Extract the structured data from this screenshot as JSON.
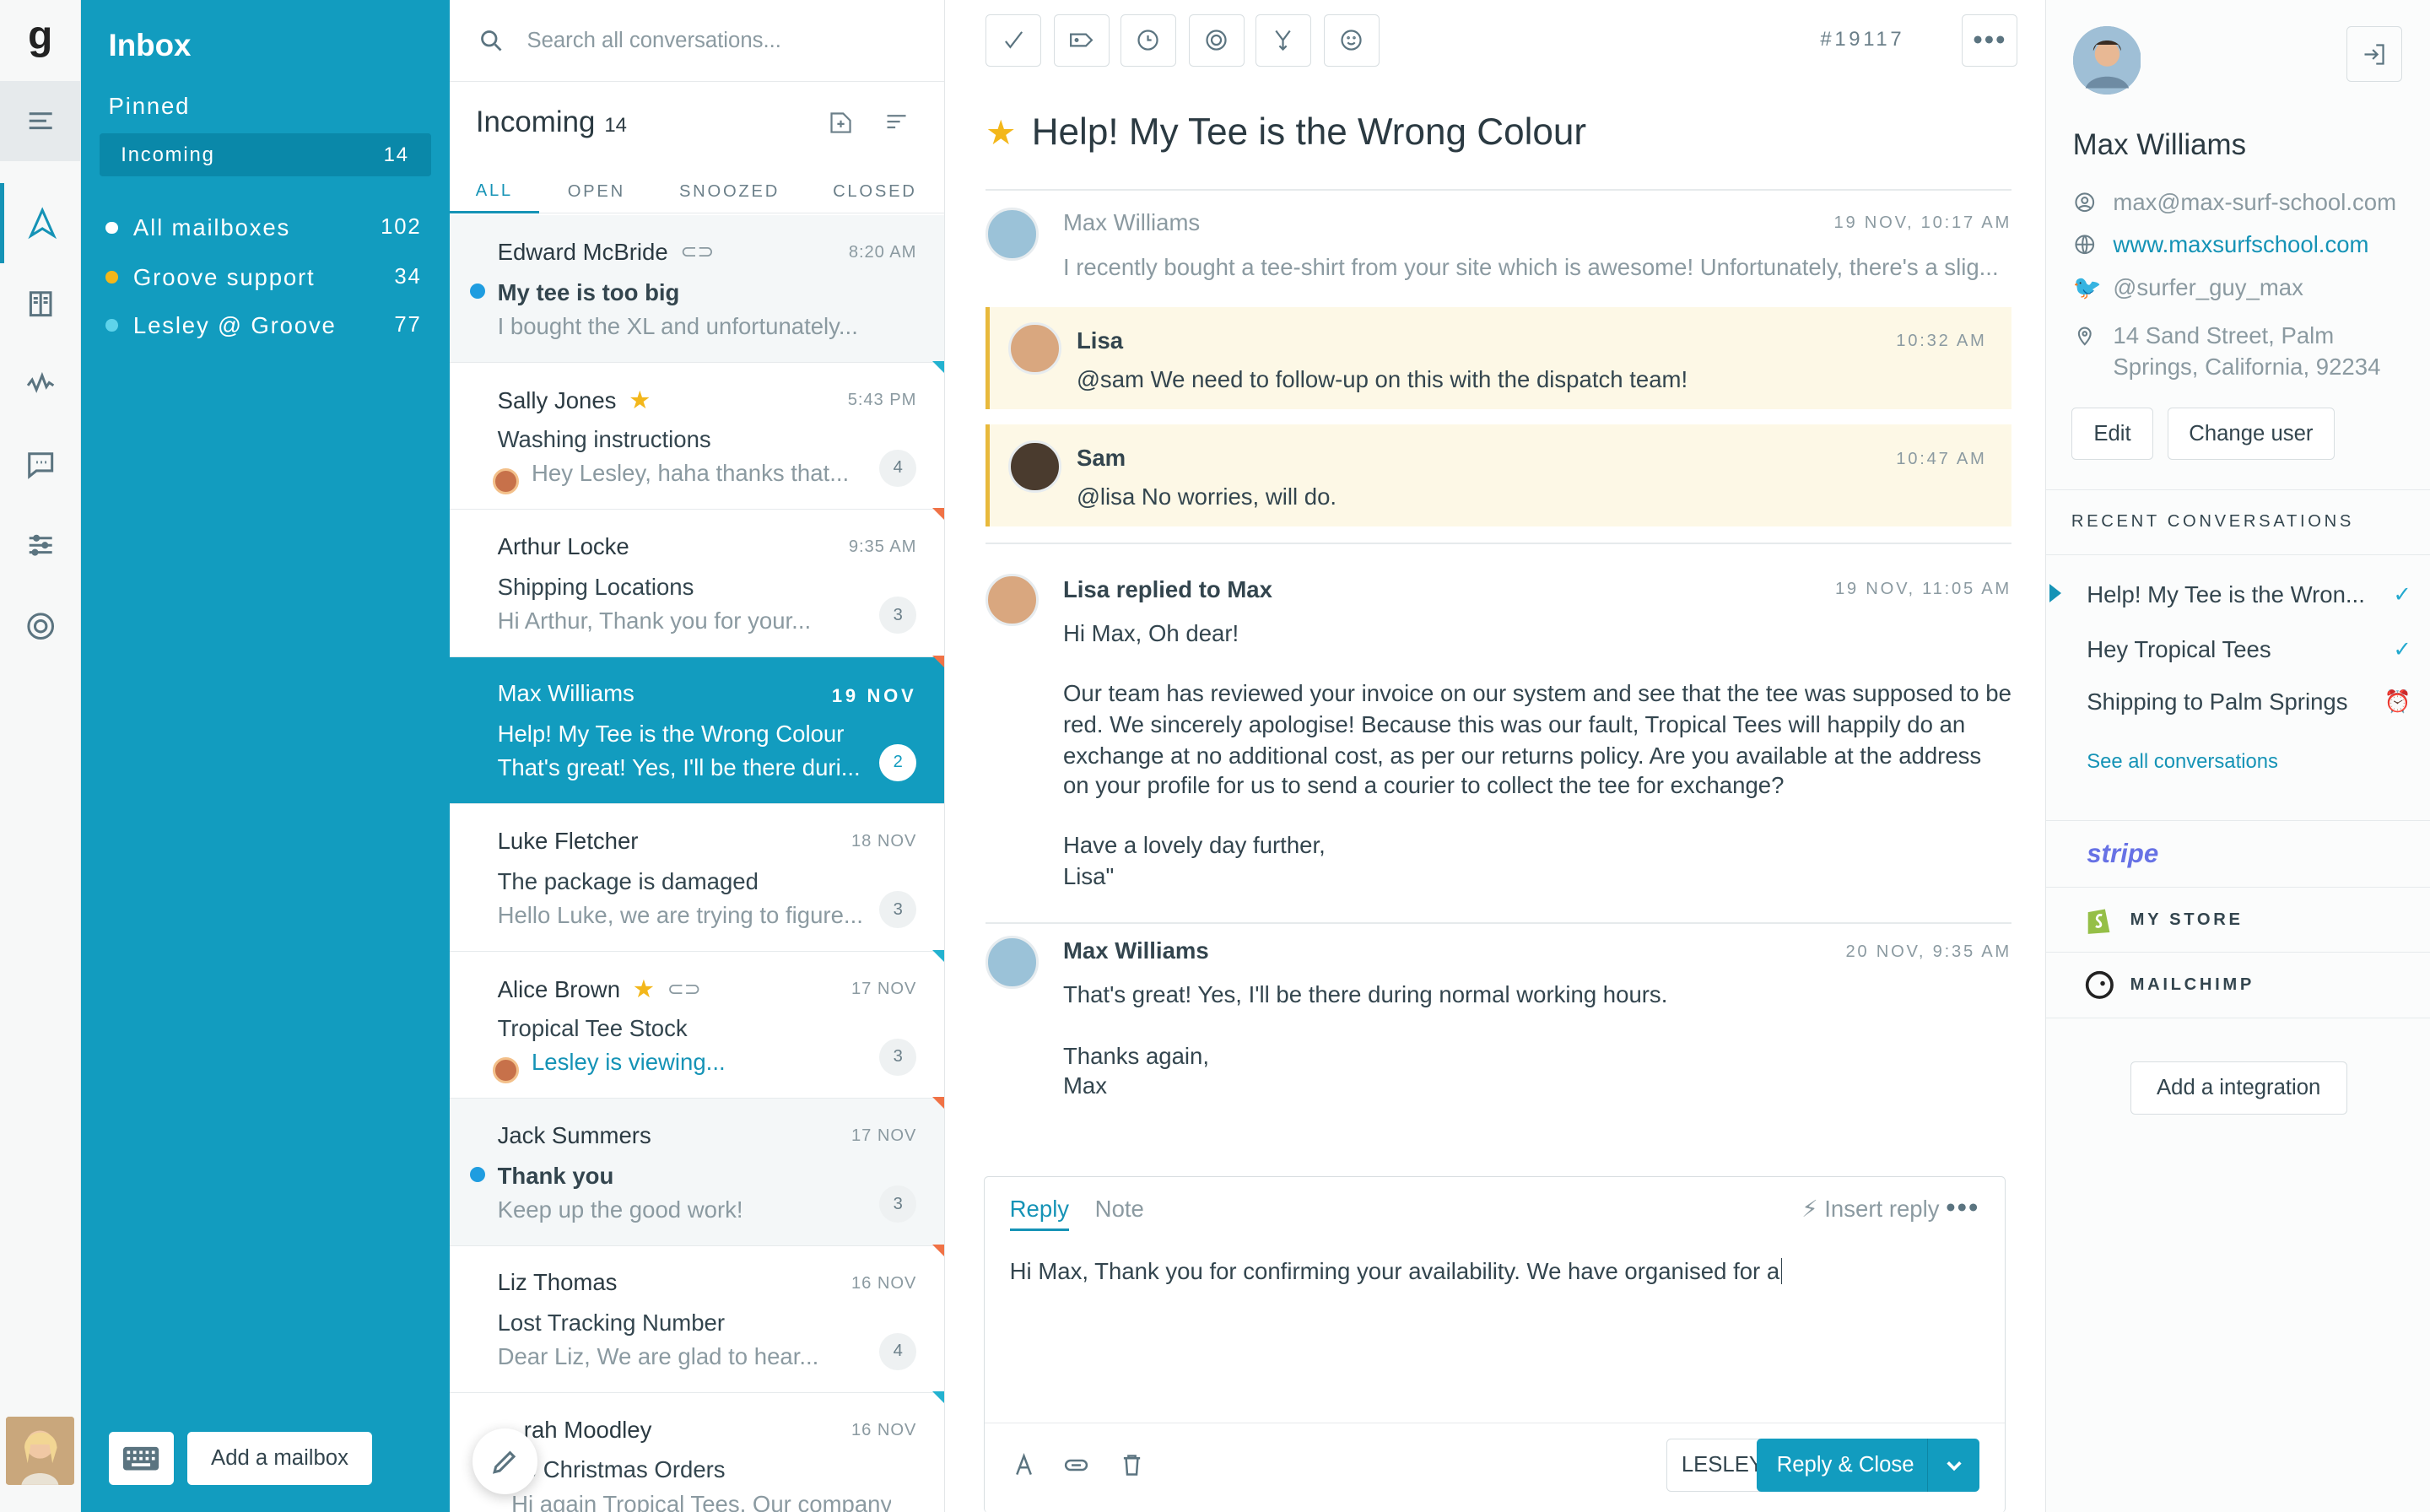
{
  "app": {
    "logo": "g"
  },
  "sidebar": {
    "title": "Inbox",
    "pinned_label": "Pinned",
    "pinned_item": {
      "label": "Incoming",
      "count": "14"
    },
    "mailboxes": [
      {
        "label": "All mailboxes",
        "count": "102",
        "color": "#ffffff"
      },
      {
        "label": "Groove support",
        "count": "34",
        "color": "#f3b71b"
      },
      {
        "label": "Lesley @ Groove",
        "count": "77",
        "color": "#5fd3ea"
      }
    ],
    "add_mailbox": "Add a mailbox"
  },
  "list": {
    "search_placeholder": "Search all conversations...",
    "heading": "Incoming",
    "count": "14",
    "tabs": [
      "ALL",
      "OPEN",
      "SNOOZED",
      "CLOSED"
    ],
    "conversations": [
      {
        "name": "Edward McBride",
        "time": "8:20 AM",
        "subject": "My tee is too big",
        "preview": "I bought the XL and unfortunately..."
      },
      {
        "name": "Sally Jones",
        "time": "5:43 PM",
        "subject": "Washing instructions",
        "preview": "Hey Lesley, haha thanks that...",
        "badge": "4"
      },
      {
        "name": "Arthur Locke",
        "time": "9:35 AM",
        "subject": "Shipping Locations",
        "preview": "Hi Arthur, Thank you for your...",
        "badge": "3"
      },
      {
        "name": "Max Williams",
        "time": "19 NOV",
        "subject": "Help! My Tee is the Wrong Colour",
        "preview": "That's great! Yes, I'll be there duri...",
        "badge": "2"
      },
      {
        "name": "Luke Fletcher",
        "time": "18 NOV",
        "subject": "The package is damaged",
        "preview": "Hello Luke, we are trying to figure...",
        "badge": "3"
      },
      {
        "name": "Alice Brown",
        "time": "17 NOV",
        "subject": "Tropical Tee Stock",
        "preview": "Lesley is viewing...",
        "badge": "3"
      },
      {
        "name": "Jack Summers",
        "time": "17 NOV",
        "subject": "Thank you",
        "preview": "Keep up the good work!",
        "badge": "3"
      },
      {
        "name": "Liz Thomas",
        "time": "16 NOV",
        "subject": "Lost Tracking Number",
        "preview": "Dear Liz, We are glad to hear...",
        "badge": "4"
      },
      {
        "name": "rah Moodley",
        "time": "16 NOV",
        "subject": "e Christmas Orders",
        "preview": "Hi again Tropical Tees, Our company"
      }
    ]
  },
  "main": {
    "ticket": "#19117",
    "subject": "Help! My Tee is the Wrong Colour",
    "messages": [
      {
        "from": "Max Williams",
        "date": "19 NOV, 10:17 AM",
        "body": "I recently bought a tee-shirt from your site which is awesome! Unfortunately, there's a slig..."
      },
      {
        "from": "Lisa",
        "date": "10:32 AM",
        "body": "@sam We need to follow-up on this with the dispatch team!"
      },
      {
        "from": "Sam",
        "date": "10:47 AM",
        "body": "@lisa No worries, will do."
      },
      {
        "from": "Lisa replied to Max",
        "date": "19 NOV, 11:05 AM",
        "body": [
          "Hi Max, Oh dear!",
          "Our team has reviewed your invoice on our system and see that the tee was supposed to be",
          "red. We sincerely apologise! Because this was our fault, Tropical Tees will happily do an",
          "exchange at no additional cost, as per our returns policy. Are you available at the address",
          "on your profile for us to send a courier to collect the tee for exchange?",
          "Have a lovely day further,",
          "Lisa\""
        ]
      },
      {
        "from": "Max Williams",
        "date": "20 NOV, 9:35 AM",
        "body": [
          "That's great! Yes, I'll be there during normal working hours.",
          "Thanks again,",
          "Max"
        ]
      }
    ],
    "composer": {
      "tab_reply": "Reply",
      "tab_note": "Note",
      "insert_reply": "Insert reply",
      "text": "Hi Max, Thank you for confirming your availability. We have organised for a",
      "assignee": "LESLEY",
      "send": "Reply & Close"
    }
  },
  "customer": {
    "name": "Max Williams",
    "email": "max@max-surf-school.com",
    "website": "www.maxsurfschool.com",
    "twitter": "@surfer_guy_max",
    "address_line1": "14 Sand Street, Palm",
    "address_line2": "Springs, California, 92234",
    "edit": "Edit",
    "change_user": "Change user",
    "recent_heading": "RECENT CONVERSATIONS",
    "recent": [
      {
        "label": "Help! My Tee is the Wron...",
        "status": "closed"
      },
      {
        "label": "Hey Tropical Tees",
        "status": "closed"
      },
      {
        "label": "Shipping to Palm Springs",
        "status": "snoozed"
      }
    ],
    "see_all": "See all conversations",
    "integrations": [
      "stripe",
      "MY STORE",
      "MAILCHIMP"
    ],
    "add_integration": "Add a integration"
  }
}
